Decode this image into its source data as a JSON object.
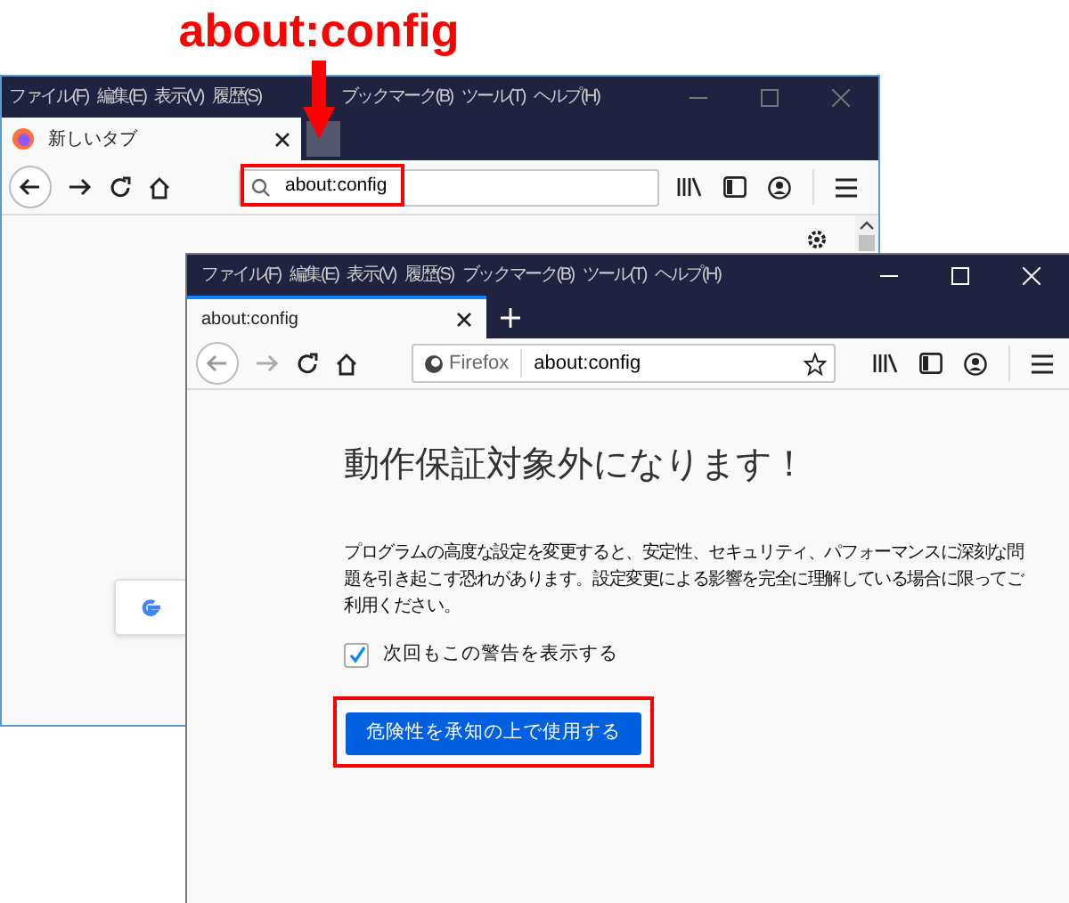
{
  "annotation": {
    "label": "about:config"
  },
  "back_window": {
    "menu": [
      "ファイル(F)",
      "編集(E)",
      "表示(V)",
      "履歴(S)",
      "ブックマーク(B)",
      "ツール(T)",
      "ヘルプ(H)"
    ],
    "tab": {
      "title": "新しいタブ"
    },
    "address": {
      "value": "about:config",
      "highlighted": true
    }
  },
  "front_window": {
    "menu": [
      "ファイル(F)",
      "編集(E)",
      "表示(V)",
      "履歴(S)",
      "ブックマーク(B)",
      "ツール(T)",
      "ヘルプ(H)"
    ],
    "tab": {
      "title": "about:config"
    },
    "identity": "Firefox",
    "address": {
      "value": "about:config"
    },
    "heading": "動作保証対象外になります！",
    "description": "プログラムの高度な設定を変更すると、安定性、セキュリティ、パフォーマンスに深刻な問題を引き起こす恐れがあります。設定変更による影響を完全に理解している場合に限ってご利用ください。",
    "checkbox": {
      "label": "次回もこの警告を表示する",
      "checked": true
    },
    "button": {
      "label": "危険性を承知の上で使用する",
      "highlighted": true
    }
  }
}
